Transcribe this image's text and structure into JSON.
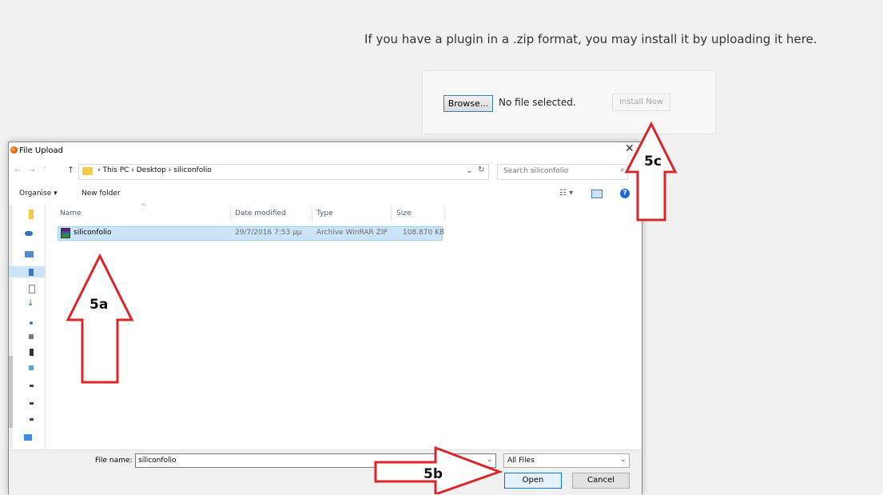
{
  "page": {
    "intro_text": "If you have a plugin in a .zip format, you may install it by uploading it here.",
    "browse_label": "Browse...",
    "no_file_text": "No file selected.",
    "install_label": "Install Now"
  },
  "dialog": {
    "title": "File Upload",
    "close_glyph": "✕",
    "breadcrumb": "›  This PC  ›  Desktop  ›  siliconfolio",
    "search_placeholder": "Search siliconfolio",
    "toolbar": {
      "organise": "Organise ▾",
      "new_folder": "New folder"
    },
    "columns": {
      "name": "Name",
      "date": "Date modified",
      "type": "Type",
      "size": "Size"
    },
    "files": [
      {
        "name": "siliconfolio",
        "date": "29/7/2016 7:53 μμ",
        "type": "Archive WinRAR ZIP",
        "size": "108.870 KB"
      }
    ],
    "footer": {
      "file_name_label": "File name:",
      "file_name_value": "siliconfolio",
      "filter_value": "All Files",
      "open_label": "Open",
      "cancel_label": "Cancel"
    }
  },
  "annotations": {
    "color": "#d8262a",
    "labels": {
      "a": "5a",
      "b": "5b",
      "c": "5c"
    }
  }
}
